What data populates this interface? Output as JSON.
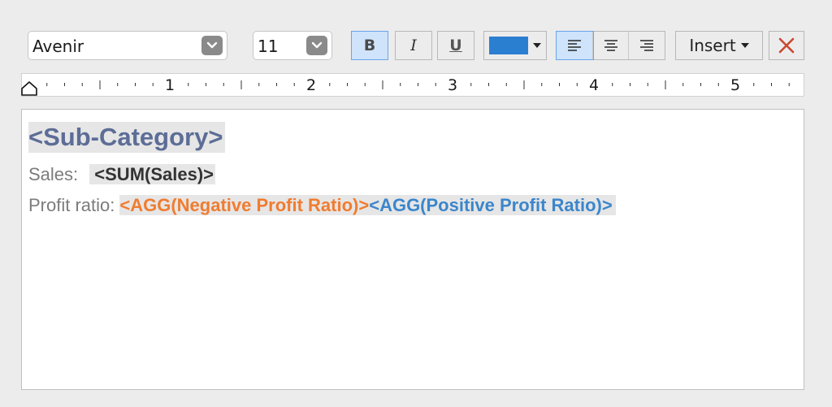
{
  "toolbar": {
    "font": "Avenir",
    "size": "11",
    "bold_label": "B",
    "italic_label": "I",
    "underline_label": "U",
    "text_color": "#2b7fd0",
    "align_options": [
      "align-left",
      "align-center",
      "align-right"
    ],
    "align_selected": "align-left",
    "insert_label": "Insert",
    "close_icon": "close-icon"
  },
  "ruler": {
    "numbers": [
      "1",
      "2",
      "3",
      "4",
      "5"
    ]
  },
  "editor": {
    "heading": "<Sub-Category>",
    "heading_color": "#5c6d96",
    "sales_label": "Sales:",
    "sales_field": "<SUM(Sales)>",
    "sales_color": "#333333",
    "profit_label": "Profit ratio:",
    "negative_field": "<AGG(Negative Profit Ratio)>",
    "negative_color": "#f07c30",
    "positive_field": "<AGG(Positive Profit Ratio)>",
    "positive_color": "#3b86cb"
  }
}
